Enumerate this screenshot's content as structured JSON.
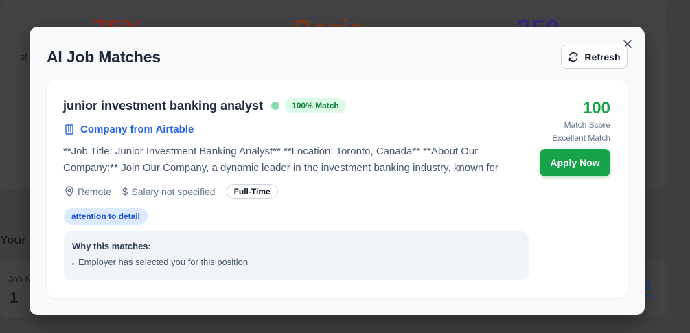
{
  "background": {
    "stat_1": "75%",
    "stat_2": "Basic",
    "stat_3": "250",
    "stat_1_color": "#8b2a22",
    "stat_2_color": "#7a3a1c",
    "stat_3_color": "#3b2a7a",
    "caption_fragment": "of",
    "section_fragment": "Your J",
    "job_label_fragment": "Job N",
    "job_count": "1"
  },
  "modal": {
    "title": "AI Job Matches",
    "refresh_label": "Refresh"
  },
  "job": {
    "title": "junior investment banking analyst",
    "match_badge": "100% Match",
    "company": "Company from Airtable",
    "description_line1": "**Job Title: Junior Investment Banking Analyst** **Location: Toronto, Canada** **About Our",
    "description_line2": "Company:** Join Our Company, a dynamic leader in the investment banking industry, known for",
    "location": "Remote",
    "salary": "Salary not specified",
    "employment_type": "Full-Time",
    "skills": [
      "attention to detail"
    ],
    "why_title": "Why this matches:",
    "why_reasons": [
      "Employer has selected you for this position"
    ],
    "score": "100",
    "score_label": "Match Score",
    "score_quality": "Excellent Match",
    "apply_label": "Apply Now"
  },
  "colors": {
    "accent_green": "#16a34a",
    "company_blue": "#2563eb",
    "badge_green_bg": "#dcfce7",
    "skill_blue_bg": "#dbeafe"
  }
}
